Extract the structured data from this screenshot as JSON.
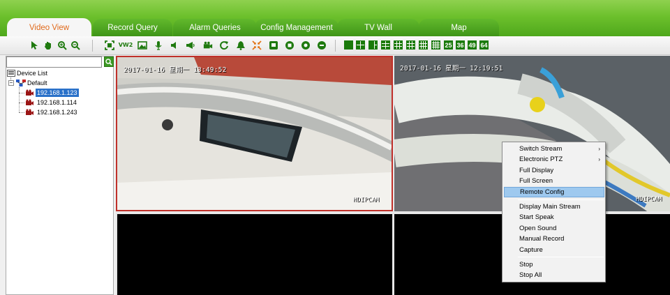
{
  "tabs": [
    {
      "label": "Video View",
      "active": true
    },
    {
      "label": "Record Query",
      "active": false
    },
    {
      "label": "Alarm Queries",
      "active": false
    },
    {
      "label": "Config Management",
      "active": false
    },
    {
      "label": "TV Wall",
      "active": false
    },
    {
      "label": "Map",
      "active": false
    }
  ],
  "toolbar": {
    "tools": [
      "select-cursor-icon",
      "pan-hand-icon",
      "zoom-in-icon",
      "zoom-out-icon",
      "fullscreen-icon",
      "vw2-icon",
      "snapshot-icon",
      "microphone-icon",
      "speaker-icon",
      "broadcast-icon",
      "video-record-icon",
      "refresh-icon",
      "alarm-bell-icon",
      "shrink-icon",
      "window-icon",
      "stop-icon",
      "record-icon",
      "pause-icon"
    ],
    "vw2_label": "VW2",
    "layout_labels": [
      "25",
      "36",
      "49",
      "64"
    ]
  },
  "device_tree": {
    "search_value": "",
    "root_label": "Device List",
    "group_label": "Default",
    "devices": [
      "192.168.1.123",
      "192.168.1.114",
      "192.168.1.243"
    ]
  },
  "video_cells": [
    {
      "timestamp": "2017-01-16 星期一 13:49:52",
      "watermark": "HDIPCAM",
      "selected": true
    },
    {
      "timestamp": "2017-01-16 星期一 12:19:51",
      "watermark": "HDIPCAM",
      "selected": false
    },
    {
      "timestamp": "",
      "watermark": "",
      "selected": false
    },
    {
      "timestamp": "",
      "watermark": "",
      "selected": false
    }
  ],
  "context_menu": {
    "items": [
      {
        "label": "Switch Stream",
        "submenu": true
      },
      {
        "label": "Electronic PTZ",
        "submenu": true
      },
      {
        "label": "Full Display",
        "submenu": false
      },
      {
        "label": "Full Screen",
        "submenu": false
      },
      {
        "label": "Remote Config",
        "submenu": false,
        "highlighted": true
      },
      {
        "label": "Display Main Stream",
        "submenu": false
      },
      {
        "label": "Start Speak",
        "submenu": false
      },
      {
        "label": "Open Sound",
        "submenu": false
      },
      {
        "label": "Manual Record",
        "submenu": false
      },
      {
        "label": "Capture",
        "submenu": false
      },
      {
        "label": "Stop",
        "submenu": false
      },
      {
        "label": "Stop All",
        "submenu": false
      }
    ],
    "submenu_arrow": "›"
  },
  "colors": {
    "header_green": "#6cc02c",
    "active_tab_text": "#e06a1c",
    "selection_blue": "#2a71c9",
    "menu_highlight": "#9ec9ef",
    "selected_cell_border": "#c0302a"
  }
}
